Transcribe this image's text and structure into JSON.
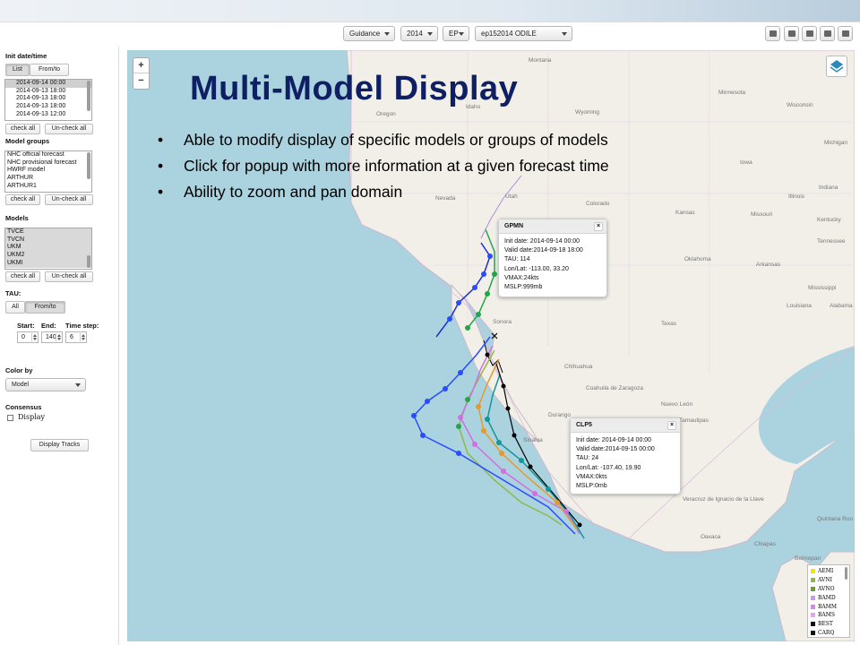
{
  "toolbar": {
    "guidance": "Guidance",
    "year": "2014",
    "basin": "EP",
    "storm": "ep152014 ODILE",
    "icons": [
      "image-icon",
      "camera-icon",
      "save-icon",
      "print-icon",
      "wrench-icon"
    ]
  },
  "panel": {
    "init_title": "Init date/time",
    "tab_list": "List",
    "tab_fromto": "From/to",
    "init_items": [
      "2014-09-14 00:00",
      "2014-09-13 18:00",
      "2014-09-13 18:00",
      "2014-09-13 18:00",
      "2014-09-13 12:00"
    ],
    "check_all": "check all",
    "uncheck_all": "Un-check all",
    "model_groups_title": "Model groups",
    "model_groups": [
      "NHC official forecast",
      "NHC provisional forecast",
      "HWRF model",
      "ARTHUR",
      "ARTHUR1"
    ],
    "models_title": "Models",
    "models": [
      "TVCE",
      "TVCN",
      "UKM",
      "UKM2",
      "UKMI"
    ],
    "tau_title": "TAU:",
    "tau_all": "All",
    "tau_fromto": "From/to",
    "start_label": "Start:",
    "end_label": "End:",
    "step_label": "Time step:",
    "start_value": "0",
    "end_value": "140",
    "step_value": "6",
    "color_by_title": "Color by",
    "color_by_value": "Model",
    "consensus_title": "Consensus",
    "display_label": "Display",
    "display_tracks": "Display Tracks"
  },
  "slide": {
    "title": "Multi-Model Display",
    "bullets": [
      "Able to modify display of specific models or groups of models",
      "Click for popup with more information at a given forecast time",
      "Ability to zoom and pan domain"
    ]
  },
  "map": {
    "zoom_in": "+",
    "zoom_out": "−",
    "labels": [
      "Montana",
      "Wyoming",
      "Idaho",
      "Oregon",
      "Utah",
      "Nevada",
      "Colorado",
      "Kansas",
      "Missouri",
      "Iowa",
      "Illinois",
      "Michigan",
      "Wisconsin",
      "Minnesota",
      "Oklahoma",
      "Arkansas",
      "Texas",
      "Louisiana",
      "Mississippi",
      "Alabama",
      "Tennessee",
      "Kentucky",
      "Indiana",
      "Chihuahua",
      "Coahuila de Zaragoza",
      "Nuevo León",
      "Tamaulipas",
      "Durango",
      "Sinaloa",
      "Sonora",
      "Belmopan",
      "Oaxaca",
      "Chiapas",
      "Veracruz de Ignacio de la Llave",
      "Quintana Roo"
    ],
    "popup_gpmn": {
      "title": "GPMN",
      "close": "×",
      "lines": [
        "Init date: 2014-09-14 00:00",
        "Valid date:2014-09-18 18:00",
        "TAU: 114",
        "Lon/Lat: -113.00, 33.20",
        "VMAX:24kts",
        "MSLP:999mb"
      ]
    },
    "popup_clp5": {
      "title": "CLP5",
      "close": "×",
      "lines": [
        "Init date: 2014-09-14 00:00",
        "Valid date:2014-09-15 00:00",
        "TAU: 24",
        "Lon/Lat: -107.40, 19.90",
        "VMAX:0kts",
        "MSLP:0mb"
      ]
    },
    "legend": [
      {
        "name": "AEMI",
        "color": "#f2e600"
      },
      {
        "name": "AVNI",
        "color": "#8fb84a"
      },
      {
        "name": "AVNO",
        "color": "#6f9a2e"
      },
      {
        "name": "BAMD",
        "color": "#c79be8"
      },
      {
        "name": "BAMM",
        "color": "#d28be0"
      },
      {
        "name": "BAMS",
        "color": "#e4a4e8"
      },
      {
        "name": "BEST",
        "color": "#111111"
      },
      {
        "name": "CARQ",
        "color": "#111111"
      }
    ]
  }
}
